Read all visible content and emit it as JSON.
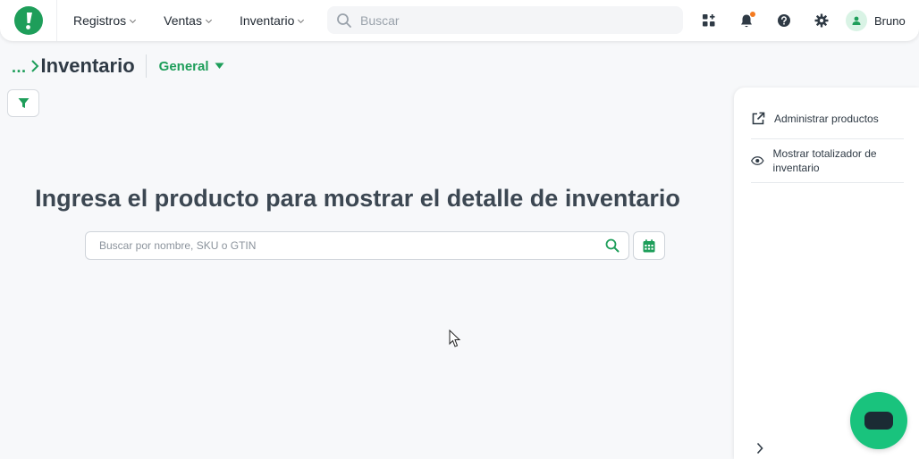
{
  "nav": {
    "items": [
      {
        "label": "Registros"
      },
      {
        "label": "Ventas"
      },
      {
        "label": "Inventario"
      }
    ],
    "search_placeholder": "Buscar",
    "user_name": "Bruno"
  },
  "breadcrumb": {
    "more": "...",
    "title": "Inventario",
    "view_label": "General"
  },
  "main": {
    "headline": "Ingresa el producto para mostrar el detalle de inventario",
    "product_search_placeholder": "Buscar por nombre, SKU o GTIN"
  },
  "side_panel": {
    "items": [
      {
        "label": "Administrar productos",
        "icon": "external-link-icon"
      },
      {
        "label": "Mostrar totalizador de inventario",
        "icon": "eye-icon"
      }
    ]
  },
  "colors": {
    "brand_green": "#1e9e5a",
    "chat_green": "#19c37d",
    "notification": "#f47b20"
  }
}
